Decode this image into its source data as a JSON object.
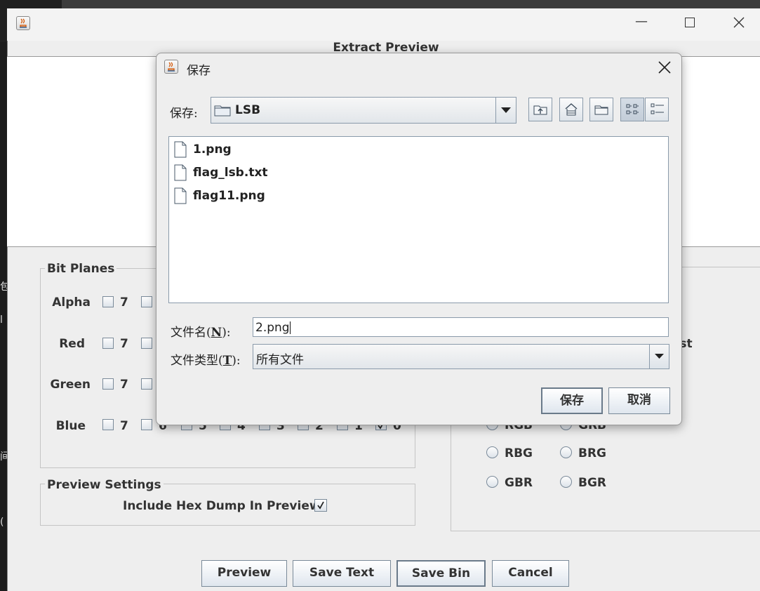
{
  "main_window": {
    "preview_title": "Extract Preview",
    "left_edge_glyphs": [
      "包",
      "l",
      "间",
      "("
    ],
    "bit_planes": {
      "title": "Bit Planes",
      "rows": [
        {
          "label": "Alpha",
          "first_num": "7"
        },
        {
          "label": "Red",
          "first_num": "7"
        },
        {
          "label": "Green",
          "first_num": "7"
        },
        {
          "label": "Blue",
          "first_num": "7",
          "partial_nums": [
            "6",
            "5",
            "4",
            "3",
            "2",
            "1",
            "0"
          ]
        }
      ]
    },
    "order_settings": {
      "partial_label": "rst",
      "partial_radios": [
        "RGB",
        "GRB"
      ],
      "radios": [
        {
          "label": "RBG"
        },
        {
          "label": "BRG"
        },
        {
          "label": "GBR"
        },
        {
          "label": "BGR"
        }
      ]
    },
    "preview_settings": {
      "title": "Preview Settings",
      "hex_dump_label": "Include Hex Dump In Preview",
      "hex_dump_checked": true
    },
    "buttons": {
      "preview": "Preview",
      "save_text": "Save Text",
      "save_bin": "Save Bin",
      "cancel": "Cancel"
    }
  },
  "save_dialog": {
    "title": "保存",
    "save_in_label": "保存:",
    "save_in_value": "LSB",
    "files": [
      "1.png",
      "flag_lsb.txt",
      "flag11.png"
    ],
    "filename_label": "文件名(N):",
    "filename_label_parts": {
      "pre": "文件名(",
      "mnemonic": "N",
      "post": "):"
    },
    "filename_value": "2.png",
    "filetype_label_parts": {
      "pre": "文件类型(",
      "mnemonic": "T",
      "post": "):"
    },
    "filetype_value": "所有文件",
    "save_button": "保存",
    "cancel_button": "取消"
  }
}
